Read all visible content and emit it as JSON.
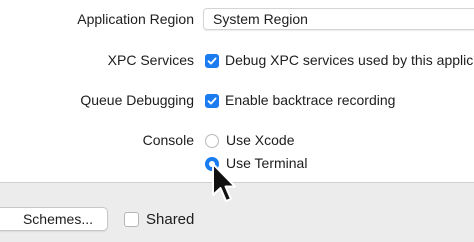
{
  "settings": {
    "application_region": {
      "label": "Application Region",
      "value": "System Region"
    },
    "xpc_services": {
      "label": "XPC Services",
      "checkbox_label": "Debug XPC services used by this applic",
      "checked": true
    },
    "queue_debugging": {
      "label": "Queue Debugging",
      "checkbox_label": "Enable backtrace recording",
      "checked": true
    },
    "console": {
      "label": "Console",
      "options": [
        {
          "label": "Use Xcode",
          "selected": false
        },
        {
          "label": "Use Terminal",
          "selected": true
        }
      ]
    }
  },
  "bottom_bar": {
    "schemes_button": "Schemes...",
    "shared_label": "Shared",
    "shared_checked": false
  },
  "colors": {
    "accent": "#1a7cf0",
    "bottom_bar_bg": "#ececec"
  },
  "icons": {
    "cursor": "arrow-pointer-icon"
  }
}
